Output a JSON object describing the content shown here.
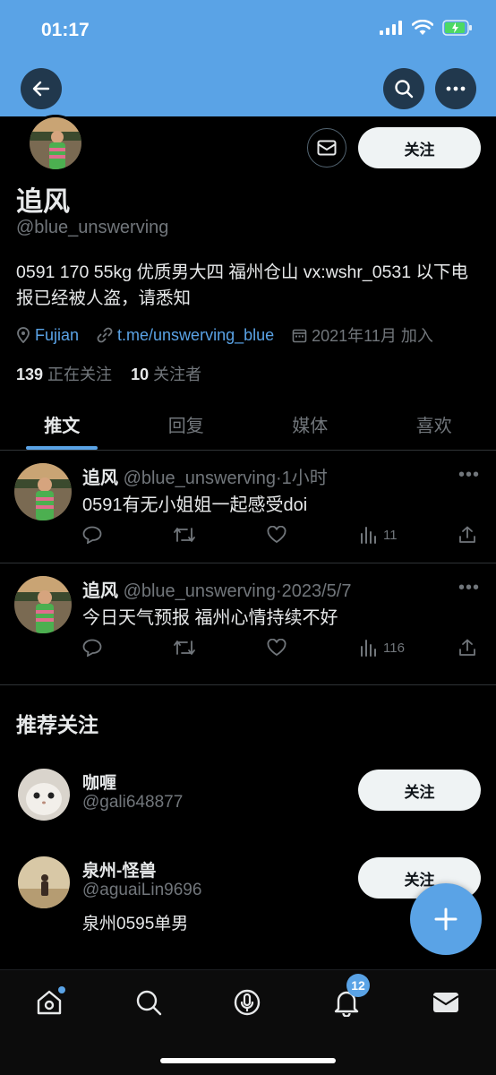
{
  "status_bar": {
    "time": "01:17"
  },
  "profile": {
    "display_name": "追风",
    "handle": "@blue_unswerving",
    "bio": "0591 170 55kg 优质男大四 福州仓山 vx:wshr_0531 以下电报已经被人盗，请悉知",
    "location": "Fujian",
    "link": "t.me/unswerving_blue",
    "joined": "2021年11月 加入",
    "following_count": "139",
    "following_label": "正在关注",
    "followers_count": "10",
    "followers_label": "关注者",
    "follow_label": "关注"
  },
  "tabs": [
    {
      "label": "推文",
      "active": true
    },
    {
      "label": "回复",
      "active": false
    },
    {
      "label": "媒体",
      "active": false
    },
    {
      "label": "喜欢",
      "active": false
    }
  ],
  "tweets": [
    {
      "name": "追风",
      "handle": "@blue_unswerving",
      "time": "·1小时",
      "text": "0591有无小姐姐一起感受doi",
      "views": "11",
      "more": "•••"
    },
    {
      "name": "追风",
      "handle": "@blue_unswerving",
      "time": "·2023/5/7",
      "text": "今日天气预报 福州心情持续不好",
      "views": "116",
      "more": "•••"
    }
  ],
  "recommend": {
    "title": "推荐关注",
    "users": [
      {
        "name": "咖喱",
        "handle": "@gali648877",
        "bio": "",
        "follow_label": "关注"
      },
      {
        "name": "泉州-怪兽",
        "handle": "@aguaiLin9696",
        "bio": "泉州0595单男",
        "follow_label": "关注"
      }
    ]
  },
  "nav": {
    "notifications_badge": "12"
  },
  "colors": {
    "accent": "#5aa3e6",
    "background": "#000000",
    "muted": "#71767b"
  }
}
